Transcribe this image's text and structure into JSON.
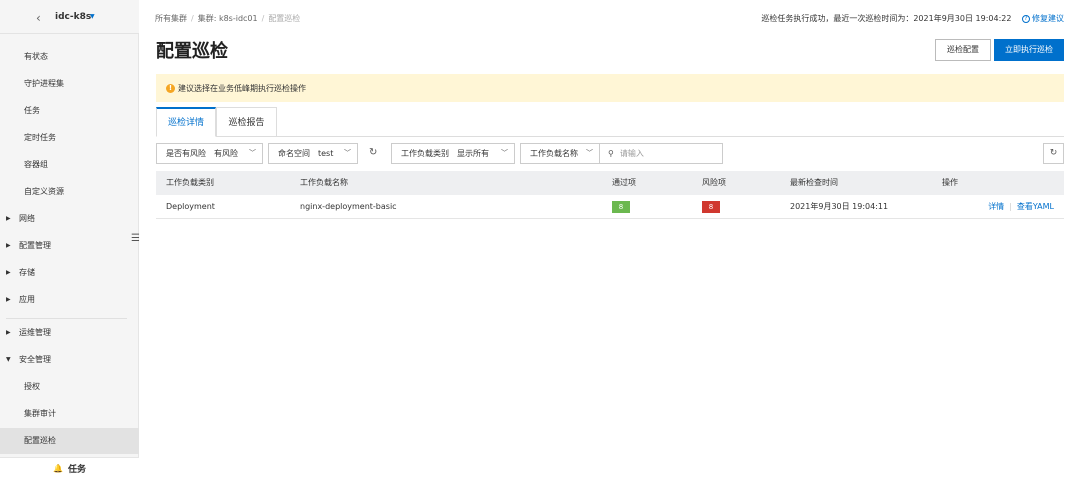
{
  "colors": {
    "accent": "#0070cc",
    "success": "#6bb84f",
    "danger": "#d0382f",
    "notice_bg": "#fff6d6",
    "warning": "#f5a623"
  },
  "sidebar": {
    "cluster_name": "idc-k8s",
    "items": [
      {
        "label": "有状态"
      },
      {
        "label": "守护进程集"
      },
      {
        "label": "任务"
      },
      {
        "label": "定时任务"
      },
      {
        "label": "容器组"
      },
      {
        "label": "自定义资源"
      }
    ],
    "groups": [
      {
        "label": "网络"
      },
      {
        "label": "配置管理"
      },
      {
        "label": "存储"
      },
      {
        "label": "应用"
      },
      {
        "label": "运维管理"
      },
      {
        "label": "安全管理"
      }
    ],
    "security_items": [
      {
        "label": "授权"
      },
      {
        "label": "集群审计"
      },
      {
        "label": "配置巡检"
      }
    ],
    "bottom_label": "任务"
  },
  "header": {
    "breadcrumb": [
      "所有集群",
      "集群:  k8s-idc01",
      "配置巡检"
    ],
    "status_text": "巡检任务执行成功，最近一次巡检时间为：2021年9月30日 19:04:22",
    "fix_label": "修复建议",
    "title": "配置巡检",
    "config_button": "巡检配置",
    "run_button": "立即执行巡检"
  },
  "notice": {
    "text": "建议选择在业务低峰期执行巡检操作"
  },
  "tabs": [
    {
      "label": "巡检详情"
    },
    {
      "label": "巡检报告"
    }
  ],
  "filters": {
    "risk": {
      "label": "是否有风险",
      "value": "有风险"
    },
    "namespace": {
      "label": "命名空间",
      "value": "test"
    },
    "workload_type": {
      "label": "工作负载类别",
      "value": "显示所有"
    },
    "workload_name": {
      "label": "工作负载名称"
    },
    "search_placeholder": "请输入"
  },
  "table": {
    "headers": [
      "工作负载类别",
      "工作负载名称",
      "通过项",
      "风险项",
      "最新检查时间",
      "操作"
    ],
    "rows": [
      {
        "type": "Deployment",
        "name": "nginx-deployment-basic",
        "passed": "8",
        "risk": "8",
        "checked_at": "2021年9月30日 19:04:11",
        "action_detail": "详情",
        "action_yaml": "查看YAML"
      }
    ]
  }
}
